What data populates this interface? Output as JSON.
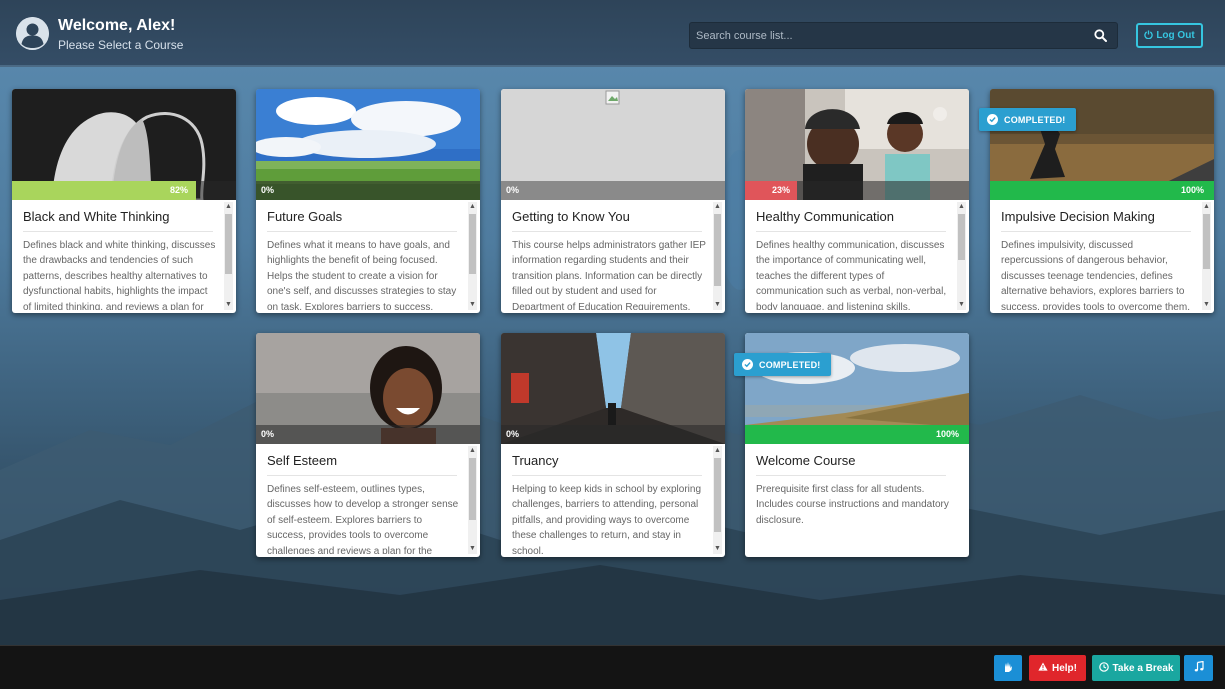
{
  "header": {
    "welcome_title": "Welcome, Alex!",
    "welcome_subtitle": "Please Select a Course",
    "search_placeholder": "Search course list...",
    "logout_label": "Log Out"
  },
  "courses": [
    {
      "title": "Black and White Thinking",
      "progress_label": "82%",
      "progress": 0.82,
      "completed": false,
      "description": "Defines black and white thinking, discusses the drawbacks and tendencies of such patterns, describes healthy alternatives to dysfunctional habits, highlights the impact of limited thinking, and reviews a plan for change."
    },
    {
      "title": "Future Goals",
      "progress_label": "0%",
      "progress": 0,
      "completed": false,
      "description": "Defines what it means to have goals, and highlights the benefit of being focused. Helps the student to create a vision for one's self, and discusses strategies to stay on task. Explores barriers to success."
    },
    {
      "title": "Getting to Know You",
      "progress_label": "0%",
      "progress": 0,
      "completed": false,
      "description": "This course helps administrators gather IEP information regarding students and their transition plans. Information can be directly filled out by student and used for Department of Education Requirements."
    },
    {
      "title": "Healthy Communication",
      "progress_label": "23%",
      "progress": 0.23,
      "completed": false,
      "description": "Defines healthy communication, discusses the importance of communicating well, teaches the different types of communication such as verbal, non-verbal, body language, and listening skills."
    },
    {
      "title": "Impulsive Decision Making",
      "progress_label": "100%",
      "progress": 1,
      "completed": true,
      "description": "Defines impulsivity, discussed repercussions of dangerous behavior, discusses teenage tendencies, defines alternative behaviors, explores barriers to success, provides tools to overcome them."
    },
    {
      "title": "Self Esteem",
      "progress_label": "0%",
      "progress": 0,
      "completed": false,
      "description": "Defines self-esteem, outlines types, discusses how to develop a stronger sense of self-esteem. Explores barriers to success, provides tools to overcome challenges and reviews a plan for the future."
    },
    {
      "title": "Truancy",
      "progress_label": "0%",
      "progress": 0,
      "completed": false,
      "description": "Helping to keep kids in school by exploring challenges, barriers to attending, personal pitfalls, and providing ways to overcome these challenges to return, and stay in school."
    },
    {
      "title": "Welcome Course",
      "progress_label": "100%",
      "progress": 1,
      "completed": true,
      "description": "Prerequisite first class for all students. Includes course instructions and mandatory disclosure."
    }
  ],
  "completed_label": "COMPLETED!",
  "footer": {
    "help_label": "Help!",
    "break_label": "Take a Break"
  },
  "colors": {
    "header_bg": "#2e4459",
    "accent": "#36c6e0",
    "progress_green": "#22b94b",
    "progress_lime": "#a9d55c",
    "progress_red": "#e0555a",
    "help_red": "#e0262b",
    "break_teal": "#1aa7a0",
    "footer_blue": "#1b8fd6",
    "badge_blue": "#2b9fd0"
  },
  "icons": [
    "user-icon",
    "search-icon",
    "power-icon",
    "check-circle-icon",
    "sign-language-icon",
    "warning-icon",
    "clock-icon",
    "music-icon"
  ]
}
